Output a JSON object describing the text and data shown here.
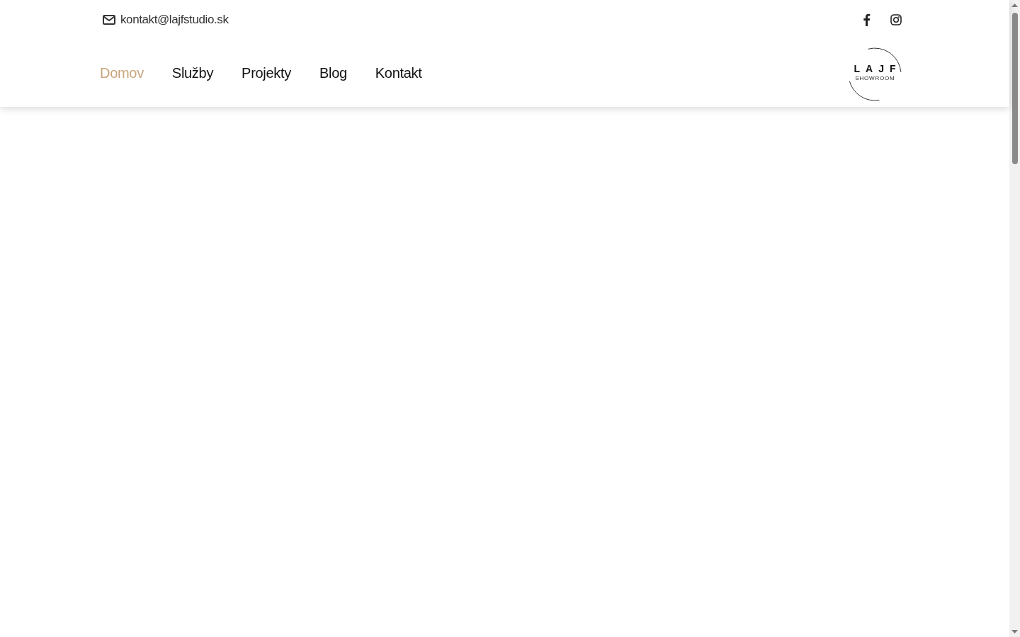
{
  "top_bar": {
    "email": "kontakt@lajfstudio.sk"
  },
  "nav": {
    "items": [
      {
        "label": "Domov",
        "selected": true
      },
      {
        "label": "Služby",
        "selected": false
      },
      {
        "label": "Projekty",
        "selected": false
      },
      {
        "label": "Blog",
        "selected": false
      },
      {
        "label": "Kontakt",
        "selected": false
      }
    ]
  },
  "logo": {
    "title": "LAJF",
    "subtitle": "SHOWROOM"
  }
}
